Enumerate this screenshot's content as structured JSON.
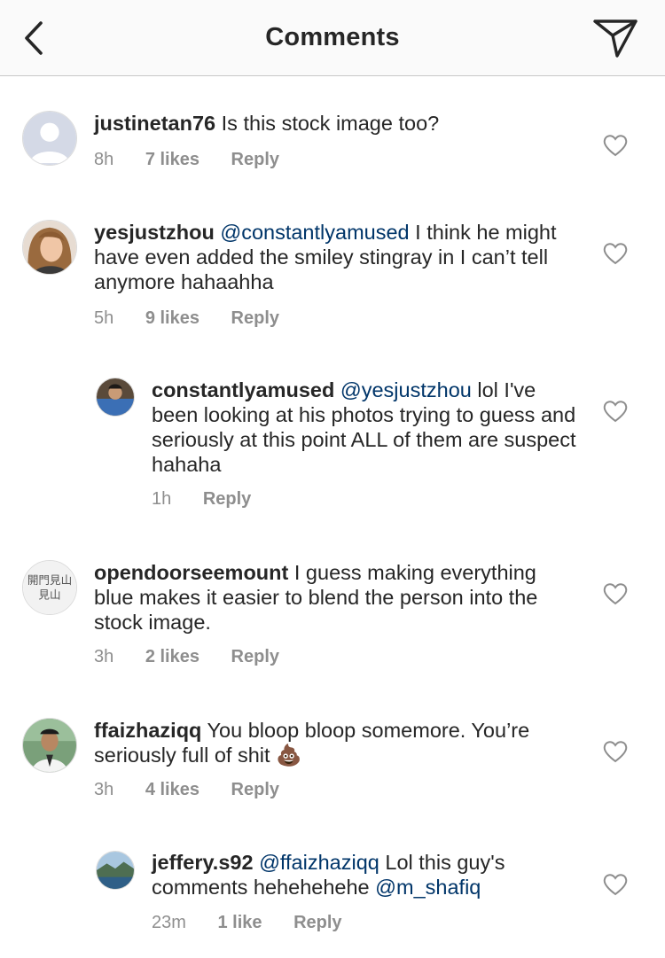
{
  "header": {
    "title": "Comments"
  },
  "comments": [
    {
      "username": "justinetan76",
      "mention": "",
      "text": "Is this stock image too?",
      "time": "8h",
      "likes": "7 likes",
      "reply": "Reply"
    },
    {
      "username": "yesjustzhou",
      "mention": "@constantlyamused",
      "text": "I think he might have even added the smiley stingray in I can’t tell anymore hahaahha",
      "time": "5h",
      "likes": "9 likes",
      "reply": "Reply"
    },
    {
      "username": "constantlyamused",
      "mention": "@yesjustzhou",
      "text": "lol I've been looking at his photos trying to guess and seriously at this point ALL of them are suspect hahaha",
      "time": "1h",
      "likes": "",
      "reply": "Reply"
    },
    {
      "username": "opendoorseemount",
      "mention": "",
      "text": "I guess making everything blue makes it easier to blend the person into the stock image.",
      "time": "3h",
      "likes": "2 likes",
      "reply": "Reply",
      "avatar_text": "開門見山"
    },
    {
      "username": "ffaizhaziqq",
      "mention": "",
      "text": "You bloop bloop somemore. You’re seriously full of shit",
      "emoji": "💩",
      "time": "3h",
      "likes": "4 likes",
      "reply": "Reply"
    },
    {
      "username": "jeffery.s92",
      "mention": "@ffaizhaziqq",
      "text": "Lol this guy's comments hehehehehe",
      "mention2": "@m_shafiq",
      "time": "23m",
      "likes": "1 like",
      "reply": "Reply"
    }
  ],
  "colors": {
    "mention": "#003569",
    "meta": "#8e8e8e",
    "text": "#262626"
  },
  "icons": {
    "back": "chevron-left-icon",
    "send": "paper-plane-icon",
    "like": "heart-outline-icon"
  }
}
